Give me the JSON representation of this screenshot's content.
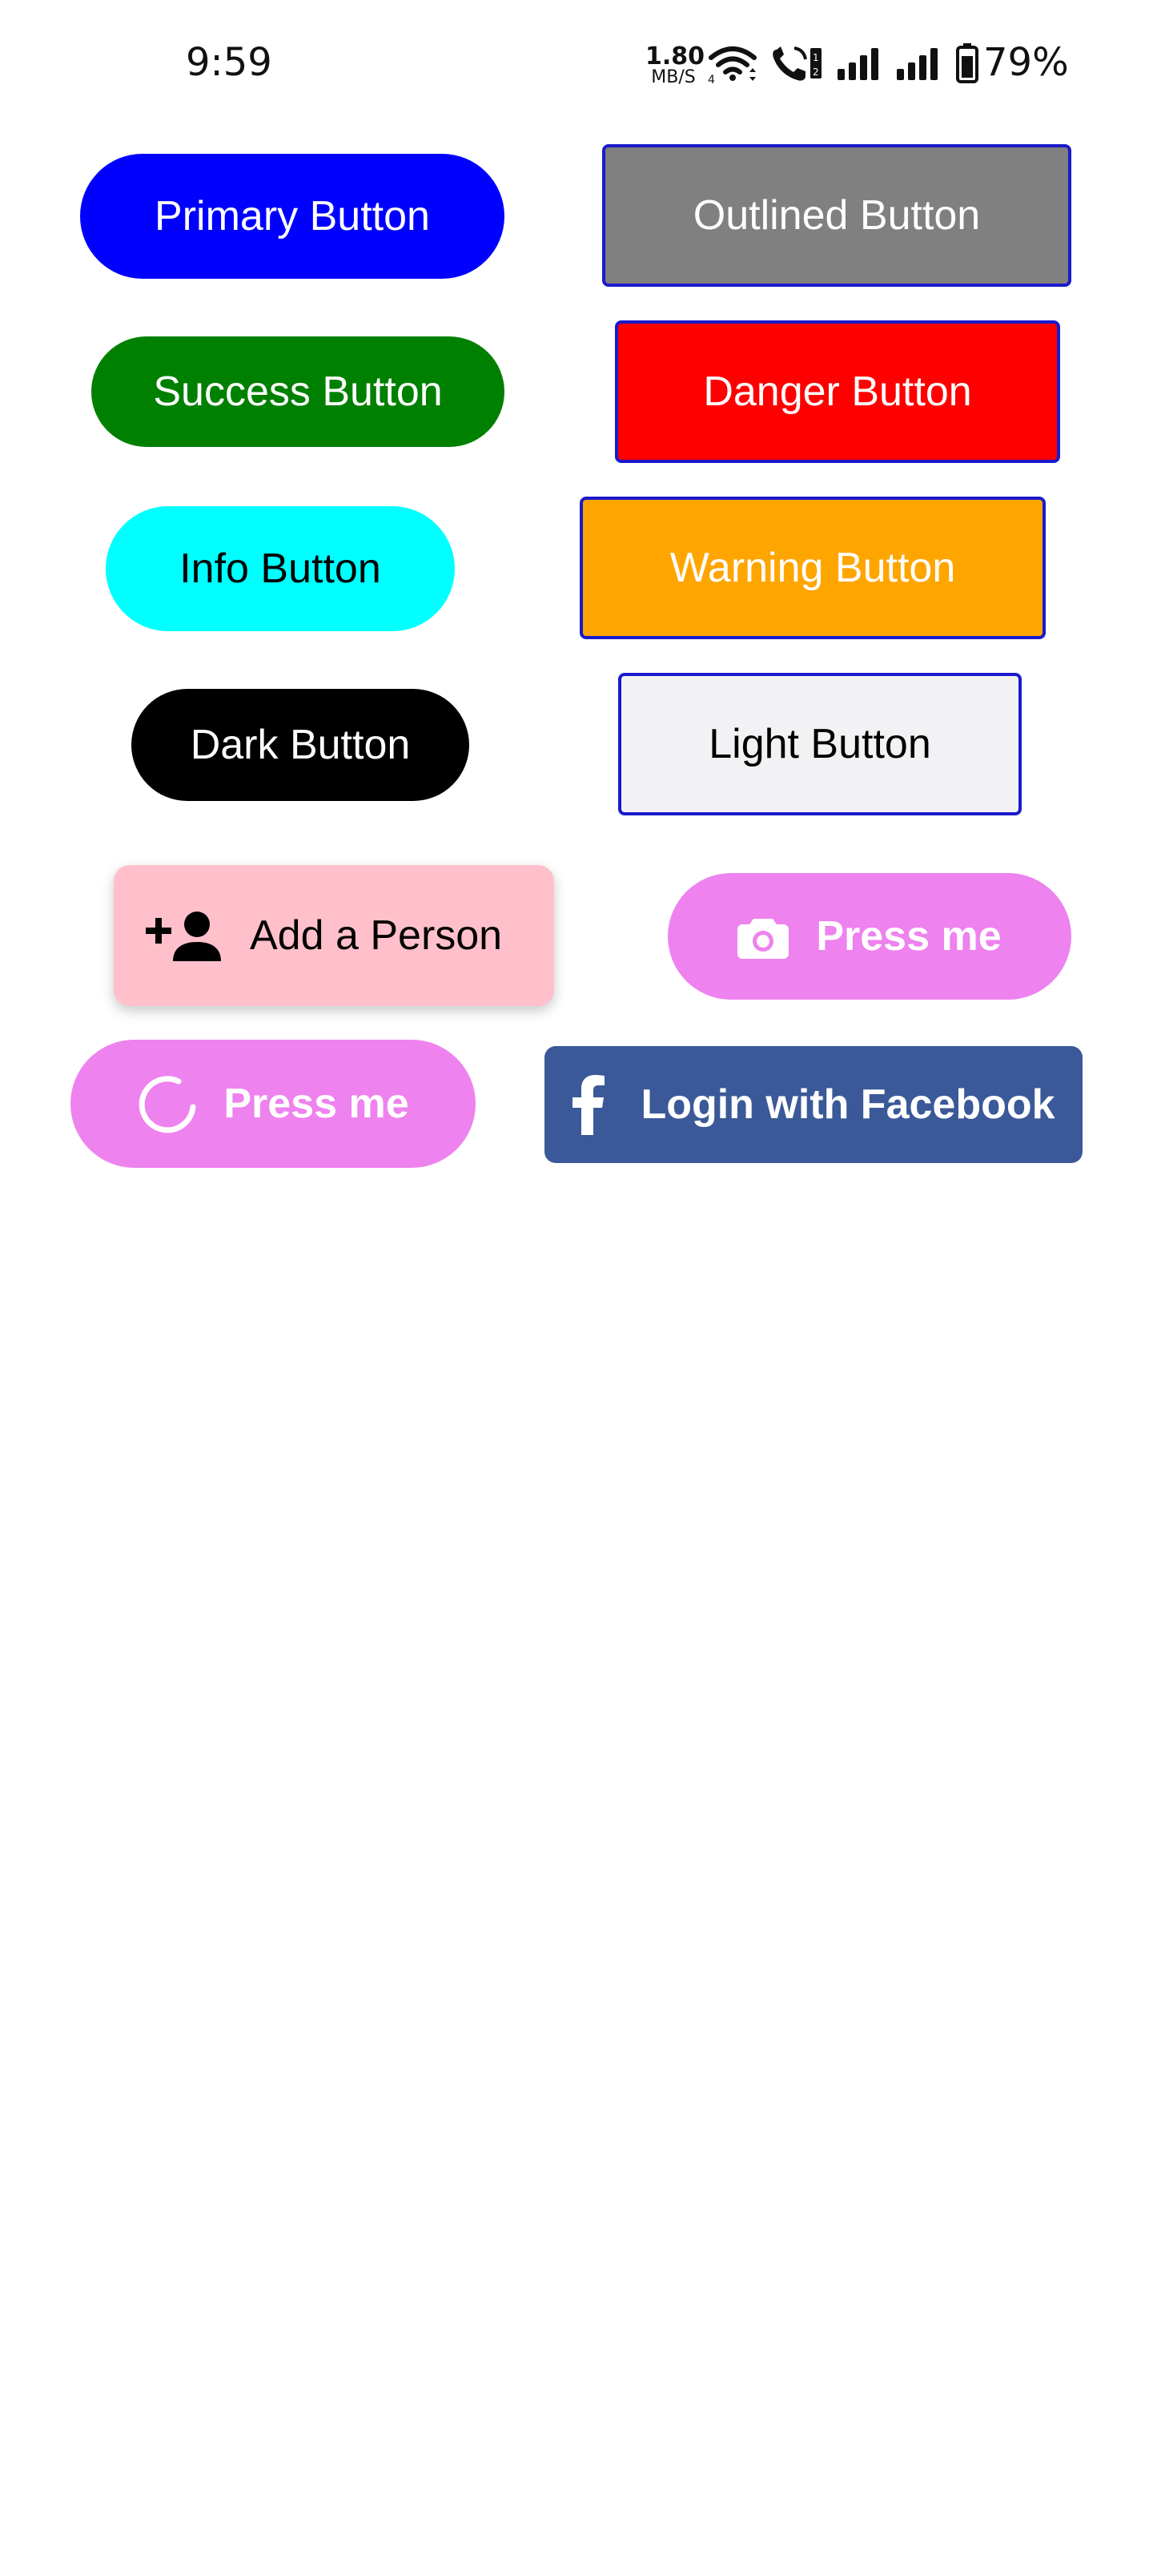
{
  "status_bar": {
    "time": "9:59",
    "network_speed_value": "1.80",
    "network_speed_unit": "MB/S",
    "battery_percent": "79%",
    "icons": [
      "wifi-icon",
      "volte-call-icon",
      "signal-icon",
      "signal-icon",
      "battery-icon"
    ]
  },
  "buttons": {
    "primary": {
      "label": "Primary Button",
      "color": "#0000ff"
    },
    "outlined": {
      "label": "Outlined Button",
      "color": "#808080"
    },
    "success": {
      "label": "Success Button",
      "color": "#008000"
    },
    "danger": {
      "label": "Danger Button",
      "color": "#ff0000"
    },
    "info": {
      "label": "Info Button",
      "color": "#00ffff"
    },
    "warning": {
      "label": "Warning Button",
      "color": "#ffa500"
    },
    "dark": {
      "label": "Dark Button",
      "color": "#000000"
    },
    "light": {
      "label": "Light Button",
      "color": "#f2f2f4"
    },
    "add_person": {
      "label": "Add a Person",
      "icon": "add-person-icon",
      "color": "#ffc0cb"
    },
    "camera": {
      "label": "Press me",
      "icon": "camera-icon",
      "color": "#ee82ee"
    },
    "loading": {
      "label": "Press me",
      "icon": "loading-spinner-icon",
      "color": "#ee82ee"
    },
    "facebook": {
      "label": "Login with Facebook",
      "icon": "facebook-icon",
      "color": "#3b5998"
    }
  },
  "colors": {
    "outline_border": "#1a1acc",
    "background": "#ffffff"
  }
}
